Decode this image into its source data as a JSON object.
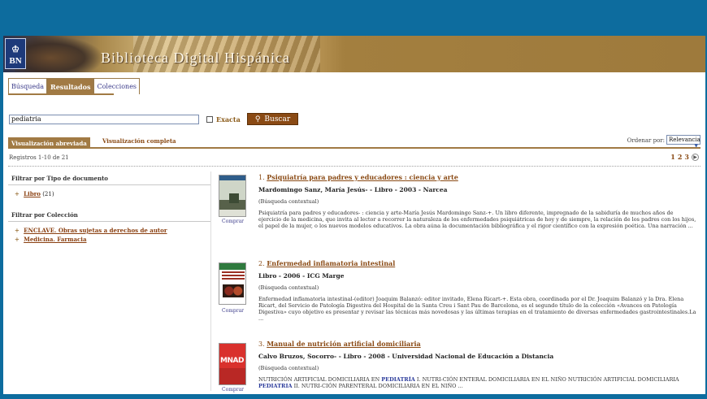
{
  "header": {
    "logo_text": "BN",
    "site_title": "Biblioteca Digital Hispánica"
  },
  "tabs": [
    {
      "label": "Búsqueda",
      "active": false
    },
    {
      "label": "Resultados",
      "active": true
    },
    {
      "label": "Colecciones",
      "active": false
    }
  ],
  "search": {
    "value": "pediatria",
    "exacta_label": "Exacta",
    "exacta_checked": false,
    "button_label": "Buscar"
  },
  "views": {
    "abreviada": "Visualización abreviada",
    "completa": "Visualización completa",
    "sort_label": "Ordenar por:",
    "sort_value": "Relevancia"
  },
  "results_count": "Registros 1-10 de 21",
  "pagination": {
    "pages": [
      "1",
      "2",
      "3"
    ],
    "next_icon": "next-circle-icon"
  },
  "filters": {
    "tipo": {
      "title": "Filtrar por Tipo de documento",
      "items": [
        {
          "label": "Libro",
          "count": "(21)"
        }
      ]
    },
    "coleccion": {
      "title": "Filtrar por Colección",
      "items": [
        {
          "label": "ENCLAVE. Obras sujetas a derechos de autor"
        },
        {
          "label": "Medicina. Farmacia"
        }
      ]
    }
  },
  "results": [
    {
      "num": "1.",
      "title": "Psiquiatría para padres y educadores : ciencia y arte",
      "meta": "Mardomingo Sanz, María Jesús-  -  Libro  -  2003  -  Narcea",
      "type": "(Búsqueda contextual)",
      "description": "Psiquiatría para padres y educadores- : ciencia y arte-María Jesús Mardomingo Sanz-+. Un libro diferente, impregnado de la sabiduría de muchos años de ejercicio de la medicina, que invita al lector a recorrer la naturaleza de los enfermedades psiquiátricas de hoy y de siempre, la relación de los padres con los hijos, el papel de la mujer, o los nuevos modelos educativos. La obra aúna la documentación bibliográfica y el rigor científico con la expresión poética. Una narración ...",
      "buy_label": "Comprar"
    },
    {
      "num": "2.",
      "title": "Enfermedad inflamatoria intestinal",
      "meta": "Libro  -  2006  -  ICG Marge",
      "type": "(Búsqueda contextual)",
      "description": "Enfermedad inflamatoria intestinal-(editor) Joaquim Balanzó: editor invitado, Elena Ricart-+. Esta obra, coordinada por el Dr. Joaquim Balanzó y la Dra. Elena Ricart, del Servicio de Patología Digestiva del Hospital de la Santa Creu i Sant Pau de Barcelona, es el segundo título de la colección «Avances en Patología Digestiva» cuyo objetivo es presentar y revisar las técnicas más novedosas y las últimas terapias en el tratamiento de diversas enfermedades gastrointestinales.La ...",
      "buy_label": "Comprar"
    },
    {
      "num": "3.",
      "title": "Manual de nutrición artificial domiciliaria",
      "meta": "Calvo Bruzos, Socorro-  -  Libro  -  2008  -  Universidad Nacional de Educación a Distancia",
      "type": "(Búsqueda contextual)",
      "desc_before": "NUTRICIÓN ARTIFICIAL DOMICILIARIA EN ",
      "desc_hl1": "PEDIATRÍA",
      "desc_mid": " I. NUTRI-CIÓN ENTERAL DOMICILIARIA EN EL NIÑO NUTRICIÓN ARTIFICIAL DOMICILIARIA ",
      "desc_hl2": "PEDIATRIA",
      "desc_after": " II. NUTRI-CIÓN PARENTERAL DOMICILIARIA EN EL NIÑO ...",
      "thumb_text": "MNAD",
      "buy_label": "Comprar"
    }
  ]
}
